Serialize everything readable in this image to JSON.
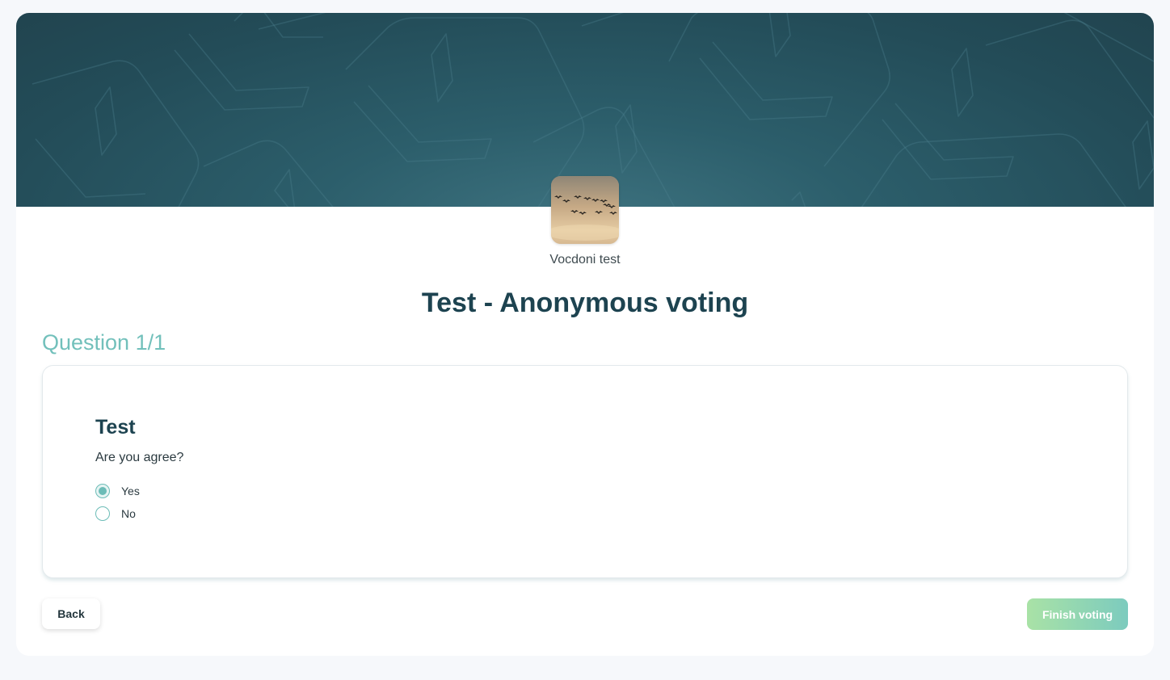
{
  "header": {
    "colors": {
      "banner": "#234c58",
      "accent": "#72c0bb"
    }
  },
  "organization": {
    "name": "Vocdoni test",
    "avatar_icon": "birds-flock-photo"
  },
  "election": {
    "title": "Test - Anonymous voting"
  },
  "question": {
    "counter": "Question 1/1",
    "title": "Test",
    "description": "Are you agree?",
    "options": [
      {
        "label": "Yes",
        "selected": true
      },
      {
        "label": "No",
        "selected": false
      }
    ]
  },
  "actions": {
    "back_label": "Back",
    "finish_label": "Finish voting"
  }
}
